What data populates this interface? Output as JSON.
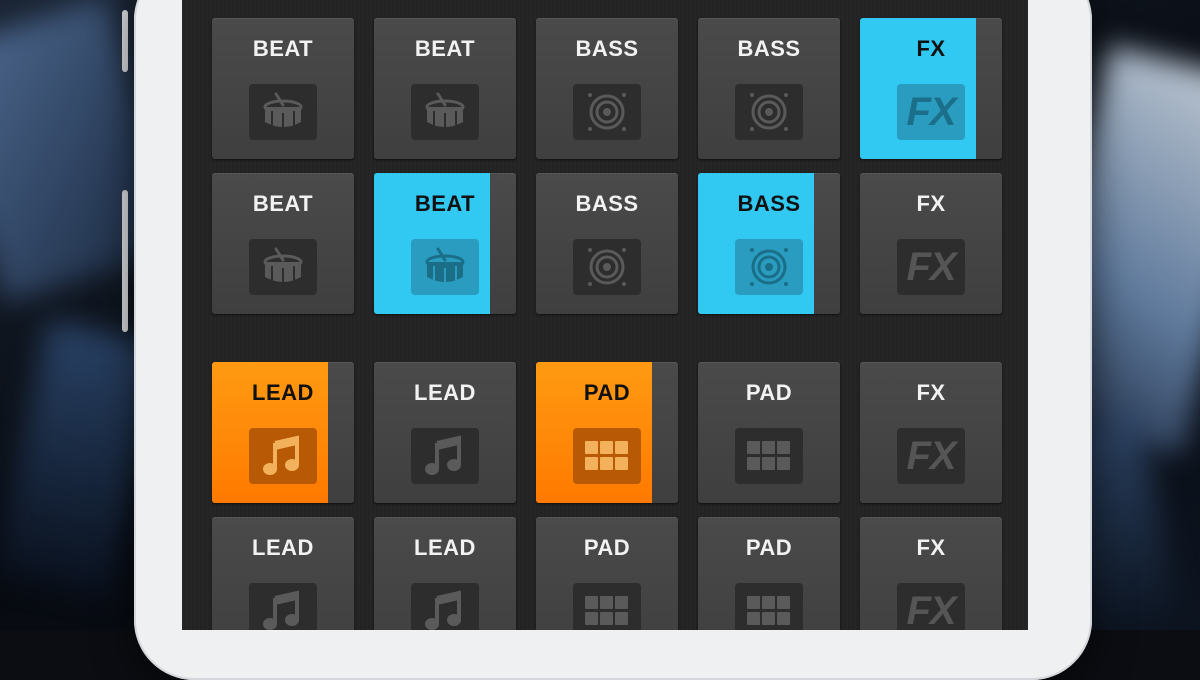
{
  "colors": {
    "cyan_active": "#31c8f2",
    "orange_active": "#ff8a00",
    "pad_idle": "#464646",
    "screen_bg": "#232323"
  },
  "top_pads": [
    {
      "label": "BEAT",
      "icon": "drum-icon",
      "active": false,
      "color": ""
    },
    {
      "label": "BEAT",
      "icon": "drum-icon",
      "active": false,
      "color": ""
    },
    {
      "label": "BASS",
      "icon": "speaker-icon",
      "active": false,
      "color": ""
    },
    {
      "label": "BASS",
      "icon": "speaker-icon",
      "active": false,
      "color": ""
    },
    {
      "label": "FX",
      "icon": "fx-icon",
      "icon_text": "FX",
      "active": true,
      "color": "cyan"
    },
    {
      "label": "BEAT",
      "icon": "drum-icon",
      "active": false,
      "color": ""
    },
    {
      "label": "BEAT",
      "icon": "drum-icon",
      "active": true,
      "color": "cyan"
    },
    {
      "label": "BASS",
      "icon": "speaker-icon",
      "active": false,
      "color": ""
    },
    {
      "label": "BASS",
      "icon": "speaker-icon",
      "active": true,
      "color": "cyan"
    },
    {
      "label": "FX",
      "icon": "fx-icon",
      "icon_text": "FX",
      "active": false,
      "color": ""
    }
  ],
  "bottom_pads": [
    {
      "label": "LEAD",
      "icon": "music-note-icon",
      "active": true,
      "color": "orange"
    },
    {
      "label": "LEAD",
      "icon": "music-note-icon",
      "active": false,
      "color": ""
    },
    {
      "label": "PAD",
      "icon": "grid-icon",
      "active": true,
      "color": "orange"
    },
    {
      "label": "PAD",
      "icon": "grid-icon",
      "active": false,
      "color": ""
    },
    {
      "label": "FX",
      "icon": "fx-icon",
      "icon_text": "FX",
      "active": false,
      "color": ""
    },
    {
      "label": "LEAD",
      "icon": "music-note-icon",
      "active": false,
      "color": ""
    },
    {
      "label": "LEAD",
      "icon": "music-note-icon",
      "active": false,
      "color": ""
    },
    {
      "label": "PAD",
      "icon": "grid-icon",
      "active": false,
      "color": ""
    },
    {
      "label": "PAD",
      "icon": "grid-icon",
      "active": false,
      "color": ""
    },
    {
      "label": "FX",
      "icon": "fx-icon",
      "icon_text": "FX",
      "active": false,
      "color": ""
    }
  ]
}
